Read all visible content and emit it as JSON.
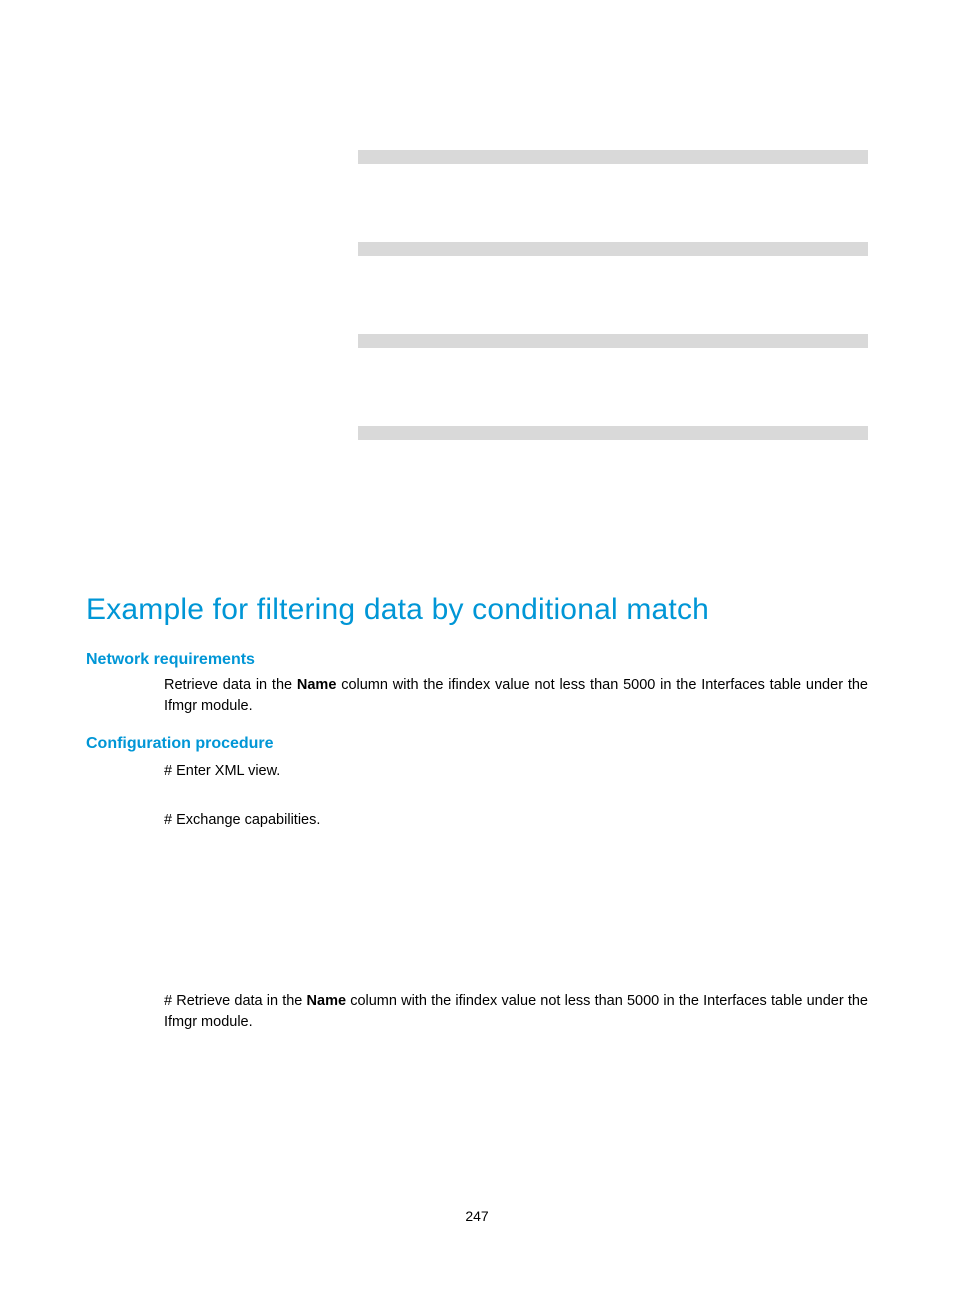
{
  "headings": {
    "main": "Example for filtering data by conditional match",
    "networkReq": "Network requirements",
    "configProc": "Configuration procedure"
  },
  "networkReq": {
    "pre": "Retrieve data in the ",
    "bold": "Name",
    "post": " column with the ifindex value not less than 5000 in the Interfaces table under the Ifmgr module."
  },
  "steps": {
    "s1": "# Enter XML view.",
    "s2": "# Exchange capabilities.",
    "s3pre": "# Retrieve data in the ",
    "s3bold": "Name",
    "s3post": " column with the ifindex value not less than 5000 in the Interfaces table under the Ifmgr module."
  },
  "pageNumber": "247"
}
